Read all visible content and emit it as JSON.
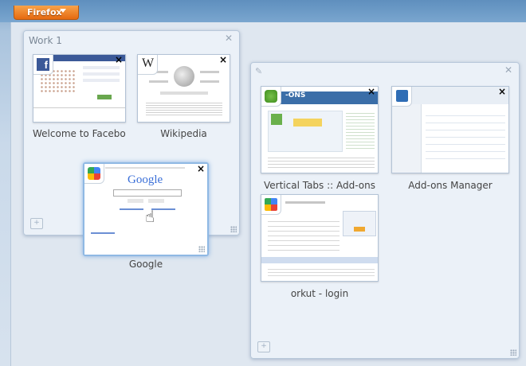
{
  "window": {
    "app_button_label": "Firefox"
  },
  "groups": [
    {
      "title": "Work 1",
      "tabs": [
        {
          "label": "Welcome to Faceboo",
          "favicon": "facebook-icon",
          "favicon_text": "f"
        },
        {
          "label": "Wikipedia",
          "favicon": "wikipedia-icon",
          "favicon_text": "W"
        }
      ]
    },
    {
      "title": "",
      "tabs": [
        {
          "label": "Vertical Tabs :: Add-ons",
          "favicon": "addons-icon",
          "thumb_text": "-ONS"
        },
        {
          "label": "Add-ons Manager",
          "favicon": "puzzle-icon"
        },
        {
          "label": "orkut - login",
          "favicon": "orkut-icon"
        }
      ]
    }
  ],
  "floating_tab": {
    "label": "Google",
    "favicon": "google-icon",
    "logo_text": "Google"
  },
  "colors": {
    "accent": "#e56a10",
    "active_glow": "#8fb9e4",
    "facebook": "#3b5998"
  }
}
